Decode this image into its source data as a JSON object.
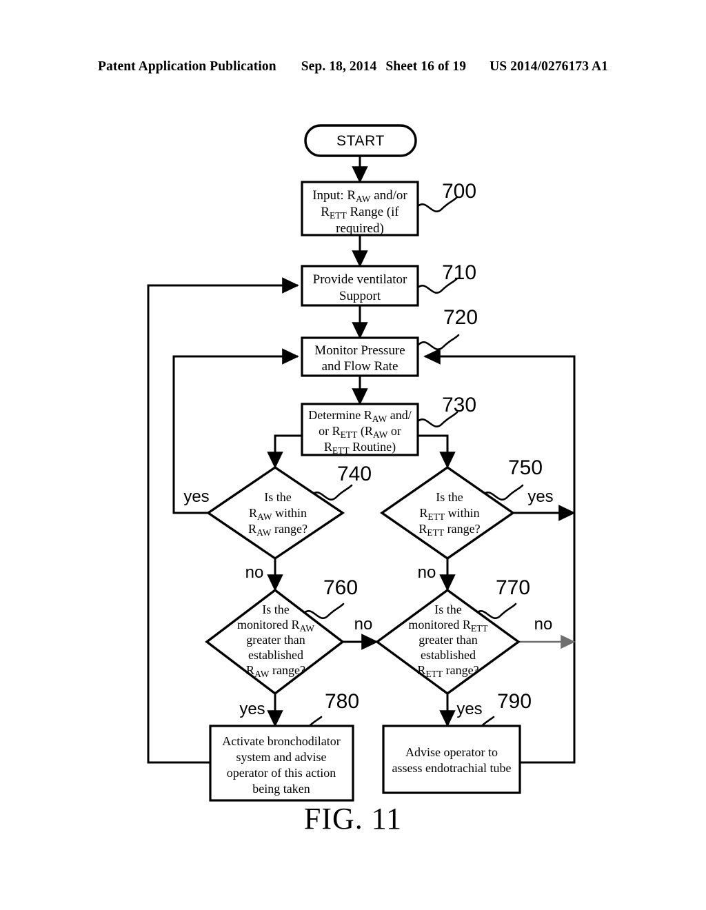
{
  "header": {
    "publication": "Patent Application Publication",
    "date": "Sep. 18, 2014",
    "sheet": "Sheet 16 of 19",
    "patent_number": "US 2014/0276173 A1"
  },
  "figure": {
    "caption": "FIG. 11"
  },
  "nodes": {
    "start": {
      "label": "START",
      "shape": "terminator"
    },
    "n700": {
      "ref": "700",
      "shape": "process",
      "lines": [
        "Input:  R_AW and/or",
        "R_ETT Range (if",
        "required)"
      ],
      "line1_a": "Input:  R",
      "line1_sub": "AW",
      "line1_b": " and/or",
      "line2_sub": "ETT",
      "line2_b": " Range (if",
      "line3": "required)"
    },
    "n710": {
      "ref": "710",
      "shape": "process",
      "line1": "Provide ventilator",
      "line2": "Support"
    },
    "n720": {
      "ref": "720",
      "shape": "process",
      "line1": "Monitor Pressure",
      "line2": "and Flow Rate"
    },
    "n730": {
      "ref": "730",
      "shape": "process",
      "line1_a": "Determine R",
      "line1_sub": "AW",
      "line1_b": " and/",
      "line2_a": "or R",
      "line2_sub1": "ETT",
      "line2_b": " (R",
      "line2_sub2": "AW",
      "line2_c": " or",
      "line3_sub": "ETT",
      "line3_b": " Routine)"
    },
    "n740": {
      "ref": "740",
      "shape": "decision",
      "line1": "Is the",
      "line2_sub": "AW",
      "line2_b": " within",
      "line3_sub": "AW",
      "line3_b": " range?",
      "yes_label": "yes",
      "no_label": "no"
    },
    "n750": {
      "ref": "750",
      "shape": "decision",
      "line1": "Is the",
      "line2_sub": "ETT",
      "line2_b": " within",
      "line3_sub": "ETT",
      "line3_b": " range?",
      "yes_label": "yes",
      "no_label": "no"
    },
    "n760": {
      "ref": "760",
      "shape": "decision",
      "line1": "Is the",
      "line2_a": "monitored R",
      "line2_sub": "AW",
      "line3": "greater than",
      "line4": "established",
      "line5_sub": "AW",
      "line5_b": " range?",
      "yes_label": "yes",
      "no_label": "no"
    },
    "n770": {
      "ref": "770",
      "shape": "decision",
      "line1": "Is the",
      "line2_a": "monitored R",
      "line2_sub": "ETT",
      "line3": "greater than",
      "line4": "established",
      "line5_sub": "ETT",
      "line5_b": " range?",
      "yes_label": "yes",
      "no_label": "no"
    },
    "n780": {
      "ref": "780",
      "shape": "process",
      "line1": "Activate bronchodilator",
      "line2": "system and advise",
      "line3": "operator of this action",
      "line4": "being taken"
    },
    "n790": {
      "ref": "790",
      "shape": "process",
      "line1": "Advise operator to",
      "line2": "assess endotrachial tube"
    }
  },
  "symbols": {
    "r_prefix": "R"
  },
  "colors": {
    "ink": "#000000",
    "paper": "#ffffff",
    "gray_arrow": "#6f6f6f"
  }
}
